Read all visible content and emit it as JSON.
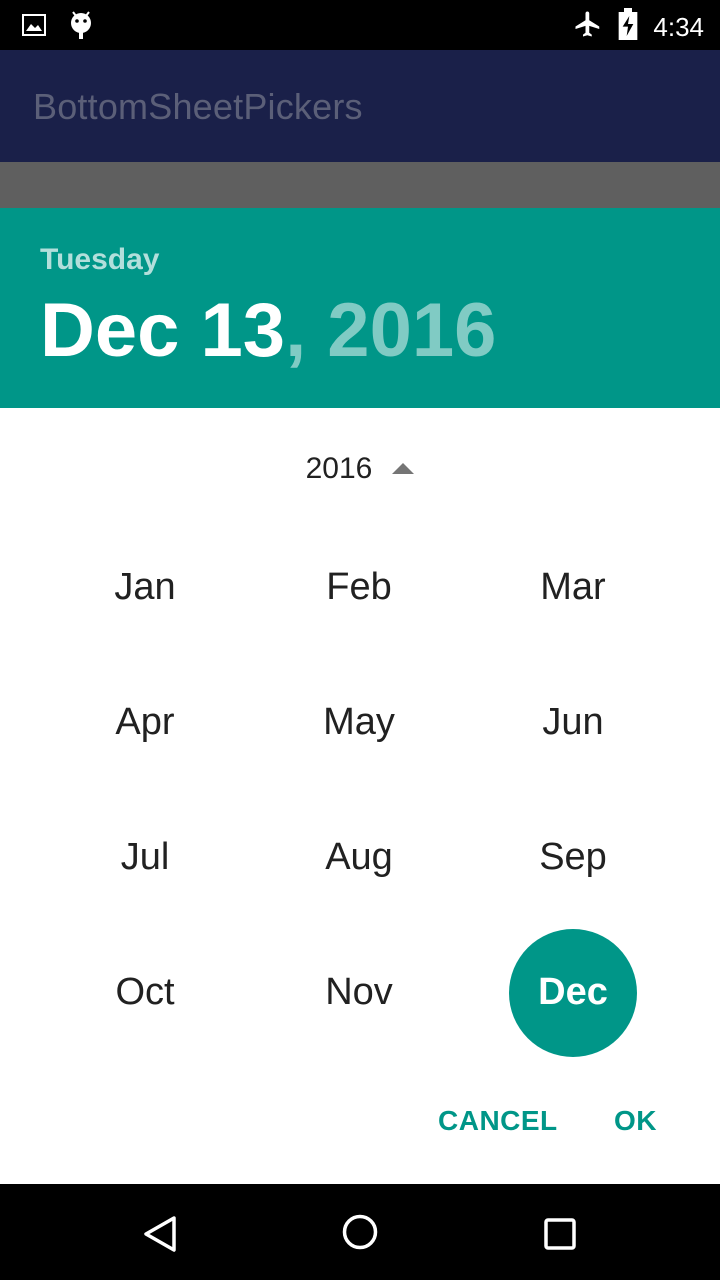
{
  "status_bar": {
    "time": "4:34",
    "left_icons": [
      "image-icon",
      "android-debug-icon"
    ],
    "right_icons": [
      "airplane-mode-icon",
      "battery-charging-icon"
    ]
  },
  "app_bar": {
    "title": "BottomSheetPickers"
  },
  "picker": {
    "header": {
      "weekday": "Tuesday",
      "date": "Dec 13",
      "year_suffix": ", 2016"
    },
    "year_label": "2016",
    "year_toggle_icon": "arrow-up-icon",
    "months": [
      "Jan",
      "Feb",
      "Mar",
      "Apr",
      "May",
      "Jun",
      "Jul",
      "Aug",
      "Sep",
      "Oct",
      "Nov",
      "Dec"
    ],
    "selected_month": "Dec",
    "actions": {
      "cancel": "CANCEL",
      "ok": "OK"
    }
  },
  "colors": {
    "accent": "#009688",
    "app_bar": "#1a2049",
    "header_year": "#80cbc4",
    "header_weekday": "#b2dfdb"
  },
  "nav_bar": {
    "icons": [
      "back-icon",
      "home-icon",
      "recents-icon"
    ]
  }
}
